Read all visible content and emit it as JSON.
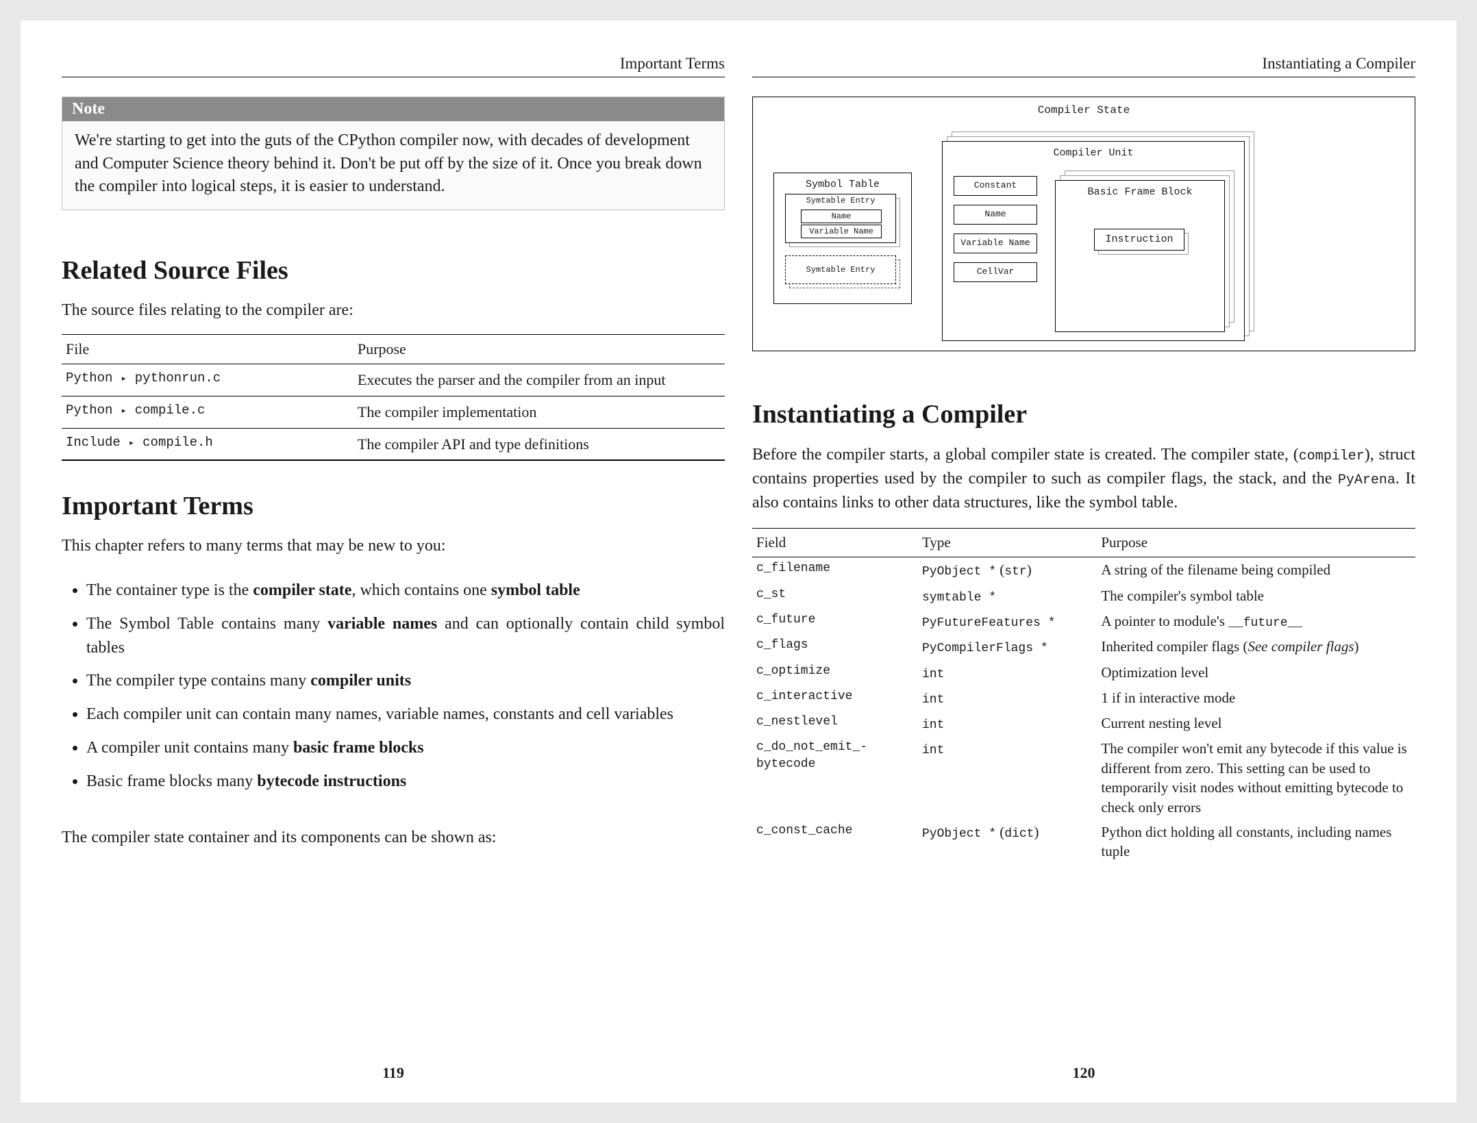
{
  "left": {
    "header": "Important Terms",
    "page_number": "119",
    "note": {
      "title": "Note",
      "body": "We're starting to get into the guts of the CPython compiler now, with decades of development and Computer Science theory behind it. Don't be put off by the size of it. Once you break down the compiler into logical steps, it is easier to understand."
    },
    "related": {
      "heading": "Related Source Files",
      "lead": "The source files relating to the compiler are:",
      "cols": [
        "File",
        "Purpose"
      ],
      "rows": [
        {
          "dir": "Python",
          "sep": "▸",
          "file": "pythonrun.c",
          "purpose": "Executes the parser and the compiler from an input"
        },
        {
          "dir": "Python",
          "sep": "▸",
          "file": "compile.c",
          "purpose": "The compiler implementation"
        },
        {
          "dir": "Include",
          "sep": "▸",
          "file": "compile.h",
          "purpose": "The compiler API and type definitions"
        }
      ]
    },
    "terms": {
      "heading": "Important Terms",
      "lead": "This chapter refers to many terms that may be new to you:",
      "items": [
        {
          "pre": "The container type is the ",
          "b": "compiler state",
          "post": ", which contains one ",
          "b2": "symbol table",
          "post2": ""
        },
        {
          "pre": "The Symbol Table contains many ",
          "b": "variable names",
          "post": " and can optionally contain child symbol tables"
        },
        {
          "pre": "The compiler type contains many ",
          "b": "compiler units",
          "post": ""
        },
        {
          "pre": "Each compiler unit can contain many names, variable names, constants and cell variables",
          "b": "",
          "post": ""
        },
        {
          "pre": "A compiler unit contains many ",
          "b": "basic frame blocks",
          "post": ""
        },
        {
          "pre": "Basic frame blocks many ",
          "b": "bytecode instructions",
          "post": ""
        }
      ],
      "outro": "The compiler state container and its components can be shown as:"
    }
  },
  "right": {
    "header": "Instantiating a Compiler",
    "page_number": "120",
    "diagram": {
      "title": "Compiler State",
      "symbol_table": "Symbol Table",
      "symtable_entry": "Symtable Entry",
      "name": "Name",
      "variable_name": "Variable Name",
      "compiler_unit": "Compiler Unit",
      "constant": "Constant",
      "cellvar": "CellVar",
      "basic_frame_block": "Basic Frame Block",
      "instruction": "Instruction"
    },
    "inst": {
      "heading": "Instantiating a Compiler",
      "para_parts": {
        "p1": "Before the compiler starts, a global compiler state is created. The compiler state, (",
        "c1": "compiler",
        "p2": "), struct contains properties used by the compiler to such as compiler flags, the stack, and the ",
        "c2": "PyArena",
        "p3": ". It also contains links to other data structures, like the symbol table."
      },
      "cols": [
        "Field",
        "Type",
        "Purpose"
      ],
      "rows": [
        {
          "field": "c_filename",
          "type_mono": "PyObject *",
          "type_paren": "str",
          "purpose": "A string of the filename being compiled"
        },
        {
          "field": "c_st",
          "type_mono": "symtable *",
          "type_paren": "",
          "purpose": "The compiler's symbol table"
        },
        {
          "field": "c_future",
          "type_mono": "PyFutureFeatures *",
          "type_paren": "",
          "purpose_pre": "A pointer to module's ",
          "purpose_code": "__future__"
        },
        {
          "field": "c_flags",
          "type_mono": "PyCompilerFlags *",
          "type_paren": "",
          "purpose_pre": "Inherited compiler flags (",
          "purpose_em": "See compiler flags",
          "purpose_post": ")"
        },
        {
          "field": "c_optimize",
          "type_mono": "int",
          "type_paren": "",
          "purpose": "Optimization level"
        },
        {
          "field": "c_interactive",
          "type_mono": "int",
          "type_paren": "",
          "purpose": "1 if in interactive mode"
        },
        {
          "field": "c_nestlevel",
          "type_mono": "int",
          "type_paren": "",
          "purpose": "Current nesting level"
        },
        {
          "field": "c_do_not_emit_-bytecode",
          "type_mono": "int",
          "type_paren": "",
          "purpose": "The compiler won't emit any bytecode if this value is different from zero. This setting can be used to temporarily visit nodes without emitting bytecode to check only errors"
        },
        {
          "field": "c_const_cache",
          "type_mono": "PyObject *",
          "type_paren": "dict",
          "purpose": "Python dict holding all constants, including names tuple"
        }
      ]
    }
  }
}
